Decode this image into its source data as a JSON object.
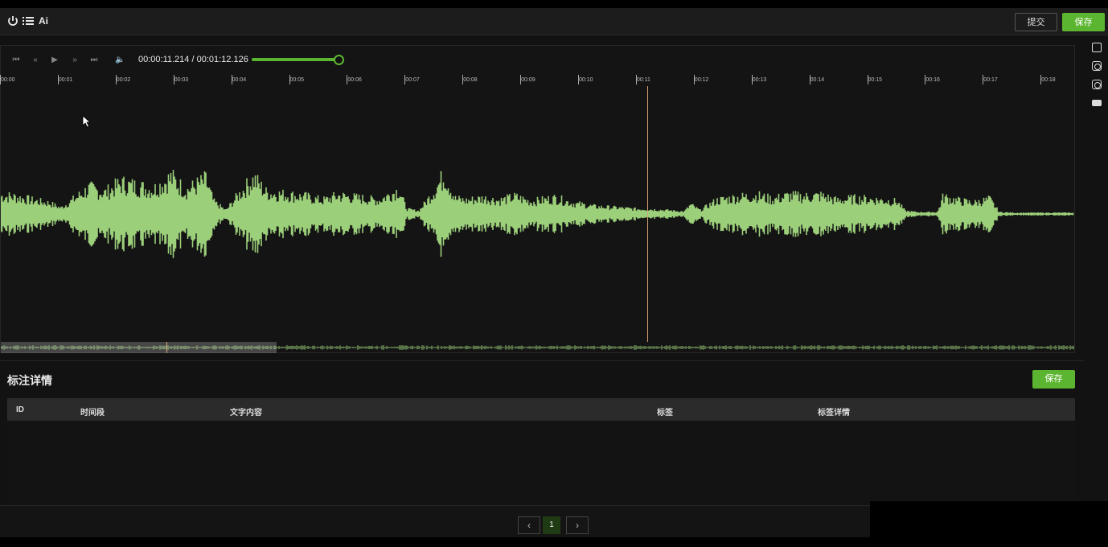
{
  "toolbar": {
    "icons": [
      "power-icon",
      "list-icon",
      "ai-icon"
    ],
    "ai_label": "Ai",
    "submit_label": "提交",
    "save_label": "保存"
  },
  "player": {
    "controls": [
      "skip-start-icon",
      "rewind-icon",
      "play-icon",
      "fast-forward-icon",
      "skip-end-icon",
      "volume-icon"
    ],
    "current_time": "00:00:11.214",
    "time_separator": " / ",
    "duration": "00:01:12.126",
    "volume_level": 1.0,
    "timeline_labels": [
      "00:00",
      "00:01",
      "00:02",
      "00:03",
      "00:04",
      "00:05",
      "00:06",
      "00:07",
      "00:08",
      "00:09",
      "00:10",
      "00:11",
      "00:12",
      "00:13",
      "00:14",
      "00:15",
      "00:16",
      "00:17",
      "00:18"
    ],
    "waveform_color": "#9ccf7a",
    "cursor_color": "#d4a373"
  },
  "side_tools": [
    "image-tool-icon",
    "circle-tool-icon",
    "circle-tool-icon-2",
    "keyboard-icon"
  ],
  "annotation": {
    "title": "标注详情",
    "save_label": "保存",
    "columns": [
      "ID",
      "时间段",
      "文字内容",
      "标签",
      "标签详情"
    ],
    "rows": []
  },
  "pagination": {
    "prev": "‹",
    "current": "1",
    "next": "›"
  },
  "colors": {
    "accent": "#5cb531",
    "background": "#121212"
  }
}
